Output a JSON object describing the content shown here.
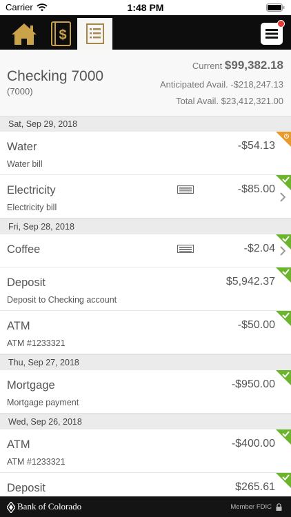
{
  "status_bar": {
    "carrier": "Carrier",
    "time": "1:48 PM"
  },
  "nav": {
    "tabs": [
      {
        "name": "home-icon"
      },
      {
        "name": "transfer-money-icon"
      },
      {
        "name": "activity-icon",
        "selected": true
      }
    ],
    "menu_icon": "hamburger-menu-icon",
    "has_notification": true
  },
  "account": {
    "name": "Checking 7000",
    "number": "(7000)",
    "current_label": "Current",
    "current_amount": "$99,382.18",
    "anticipated_label": "Anticipated Avail.",
    "anticipated_amount": "-$218,247.13",
    "total_label": "Total Avail.",
    "total_amount": "$23,412,321.00"
  },
  "groups": [
    {
      "date": "Sat, Sep 29, 2018",
      "items": [
        {
          "title": "Water",
          "description": "Water bill",
          "amount": "-$54.13",
          "status": "pending"
        },
        {
          "title": "Electricity",
          "description": "Electricity bill",
          "amount": "-$85.00",
          "status": "cleared",
          "has_receipt": true,
          "has_chevron": true
        }
      ]
    },
    {
      "date": "Fri, Sep 28, 2018",
      "items": [
        {
          "title": "Coffee",
          "description": "",
          "amount": "-$2.04",
          "status": "cleared",
          "has_receipt": true,
          "has_chevron": true
        },
        {
          "title": "Deposit",
          "description": "Deposit to Checking account",
          "amount": "$5,942.37",
          "status": "cleared"
        },
        {
          "title": "ATM",
          "description": "ATM #1233321",
          "amount": "-$50.00",
          "status": "cleared"
        }
      ]
    },
    {
      "date": "Thu, Sep 27, 2018",
      "items": [
        {
          "title": "Mortgage",
          "description": "Mortgage payment",
          "amount": "-$950.00",
          "status": "cleared"
        }
      ]
    },
    {
      "date": "Wed, Sep 26, 2018",
      "items": [
        {
          "title": "ATM",
          "description": "ATM #1233321",
          "amount": "-$400.00",
          "status": "cleared"
        },
        {
          "title": "Deposit",
          "description": "",
          "amount": "$265.61",
          "status": "cleared"
        }
      ]
    }
  ],
  "footer": {
    "bank_name": "Bank of Colorado",
    "fdic": "Member FDIC"
  },
  "colors": {
    "nav_bg": "#0d0d0d",
    "gold": "#c9a24a",
    "cleared_green": "#6bb52c",
    "pending_orange": "#e89b2a",
    "date_header_bg": "#ebebeb"
  }
}
